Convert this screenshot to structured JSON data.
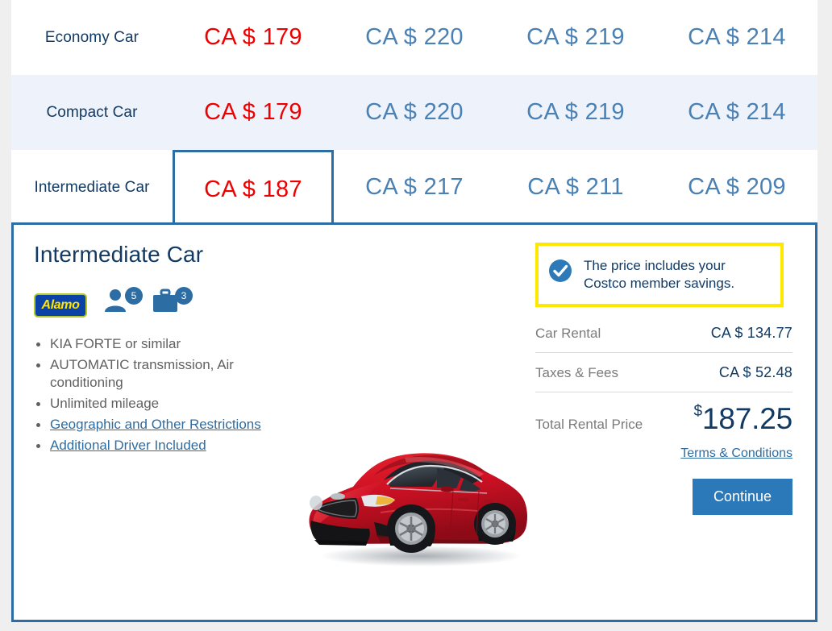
{
  "rate_table": {
    "rows": [
      {
        "label": "Economy Car",
        "cells": [
          {
            "value": "CA $ 179",
            "state": "best"
          },
          {
            "value": "CA $ 220",
            "state": "normal"
          },
          {
            "value": "CA $ 219",
            "state": "normal"
          },
          {
            "value": "CA $ 214",
            "state": "normal"
          }
        ]
      },
      {
        "label": "Compact Car",
        "cells": [
          {
            "value": "CA $ 179",
            "state": "best"
          },
          {
            "value": "CA $ 220",
            "state": "normal"
          },
          {
            "value": "CA $ 219",
            "state": "normal"
          },
          {
            "value": "CA $ 214",
            "state": "normal"
          }
        ]
      },
      {
        "label": "Intermediate Car",
        "cells": [
          {
            "value": "CA $ 187",
            "state": "best selected"
          },
          {
            "value": "CA $ 217",
            "state": "normal"
          },
          {
            "value": "CA $ 211",
            "state": "normal"
          },
          {
            "value": "CA $ 209",
            "state": "normal"
          }
        ]
      }
    ]
  },
  "detail": {
    "title": "Intermediate Car",
    "vendor": {
      "name": "Alamo"
    },
    "capacity": {
      "passengers": "5",
      "luggage": "3"
    },
    "features": [
      {
        "text": "KIA FORTE or similar",
        "link": false
      },
      {
        "text": "AUTOMATIC transmission, Air conditioning",
        "link": false
      },
      {
        "text": "Unlimited mileage",
        "link": false
      },
      {
        "text": "Geographic and Other Restrictions",
        "link": true
      },
      {
        "text": "Additional Driver Included",
        "link": true
      }
    ],
    "notice": {
      "text": "The price includes your Costco member savings."
    },
    "pricing": {
      "car_rental_label": "Car Rental",
      "car_rental_value": "CA $ 134.77",
      "taxes_label": "Taxes & Fees",
      "taxes_value": "CA $ 52.48",
      "total_label": "Total Rental Price",
      "total_currency": "$",
      "total_amount": "187.25"
    },
    "terms_label": "Terms & Conditions",
    "continue_label": "Continue"
  },
  "colors": {
    "accent_blue": "#2c6da3",
    "best_price_red": "#ee0000",
    "price_blue": "#4a81b4",
    "navy": "#123a63",
    "notice_yellow": "#ffe800",
    "button_blue": "#2b79b8",
    "car_body_red": "#cf1124"
  }
}
